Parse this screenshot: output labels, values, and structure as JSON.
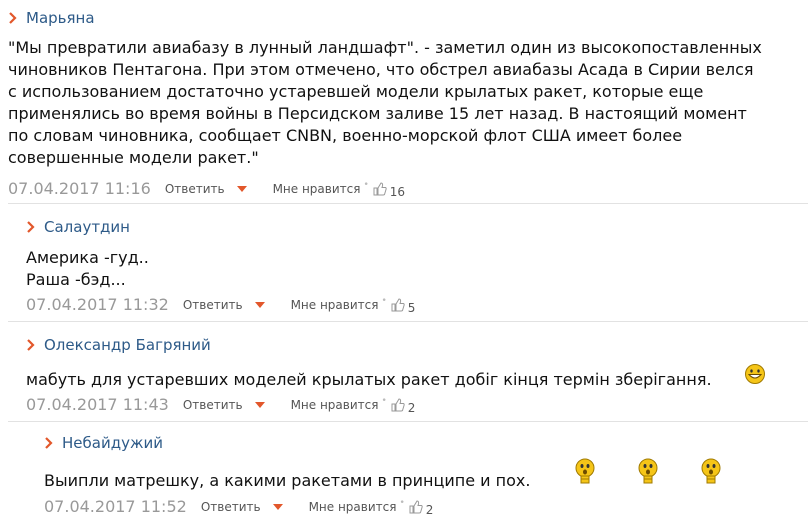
{
  "comments": [
    {
      "author": "Марьяна",
      "lines": [
        "\"Мы превратили авиабазу в лунный ландшафт\". - заметил один из высокопоставленных",
        "чиновников Пентагона. При этом отмечено, что обстрел авиабазы Асада в Сирии велся",
        "с использованием достаточно устаревшей модели крылатых ракет, которые еще",
        "применялись во время войны в Персидском заливе 15 лет назад. В настоящий момент",
        "по словам чиновника, сообщает CNBN, военно-морской флот США имеет более",
        "совершенные модели ракет.\""
      ],
      "date": "07.04.2017 11:16",
      "reply": "Ответить",
      "like": "Мне нравится",
      "likes": "16"
    },
    {
      "author": "Салаутдин",
      "lines": [
        "Америка -гуд..",
        "Раша -бэд..."
      ],
      "date": "07.04.2017 11:32",
      "reply": "Ответить",
      "like": "Мне нравится",
      "likes": "5"
    },
    {
      "author": "Олександр Багряний",
      "lines": [
        "мабуть для устаревших моделей крылатых ракет добіг кінця термін зберігання."
      ],
      "date": "07.04.2017 11:43",
      "reply": "Ответить",
      "like": "Мне нравится",
      "likes": "2",
      "emoji": "grinning-smiley-icon"
    },
    {
      "author": "Небайдужий",
      "lines": [
        "Выипли матрешку, а какими ракетами в принципе и пох."
      ],
      "date": "07.04.2017 11:52",
      "reply": "Ответить",
      "like": "Мне нравится",
      "likes": "2",
      "emoji": "lightbulb-smiley-icon"
    }
  ],
  "colors": {
    "author": "#2d5a88",
    "arrow": "#e2572b",
    "date": "#999999",
    "divider": "#e2e2e2"
  }
}
